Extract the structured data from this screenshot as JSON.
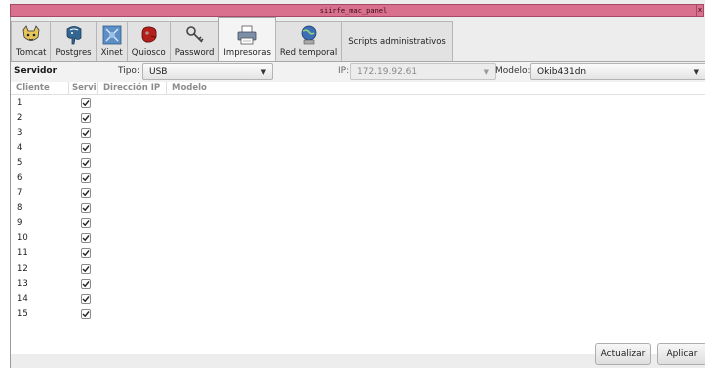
{
  "window": {
    "title": "siirfe_mac_panel",
    "close_glyph": "x"
  },
  "tabs": [
    {
      "label": "Tomcat",
      "icon": "tomcat-icon"
    },
    {
      "label": "Postgres",
      "icon": "postgres-elephant-icon"
    },
    {
      "label": "Xinet",
      "icon": "xinet-icon"
    },
    {
      "label": "Quiosco",
      "icon": "quiosco-icon"
    },
    {
      "label": "Password",
      "icon": "keys-icon"
    },
    {
      "label": "Impresoras",
      "icon": "printer-icon",
      "active": true
    },
    {
      "label": "Red temporal",
      "icon": "network-globe-icon"
    },
    {
      "label": "Scripts administrativos"
    }
  ],
  "toolbar": {
    "servidor_label": "Servidor",
    "tipo_label": "Tipo:",
    "tipo_value": "USB",
    "ip_label": "IP:",
    "ip_value": "172.19.92.61",
    "modelo_label": "Modelo:",
    "modelo_value": "Okib431dn"
  },
  "table": {
    "headers": [
      "Cliente",
      "Servi",
      "Dirección IP",
      "Modelo"
    ],
    "rows": [
      {
        "cliente": "1",
        "checked": true
      },
      {
        "cliente": "2",
        "checked": true
      },
      {
        "cliente": "3",
        "checked": true
      },
      {
        "cliente": "4",
        "checked": true
      },
      {
        "cliente": "5",
        "checked": true
      },
      {
        "cliente": "6",
        "checked": true
      },
      {
        "cliente": "7",
        "checked": true
      },
      {
        "cliente": "8",
        "checked": true
      },
      {
        "cliente": "9",
        "checked": true
      },
      {
        "cliente": "10",
        "checked": true
      },
      {
        "cliente": "11",
        "checked": true
      },
      {
        "cliente": "12",
        "checked": true
      },
      {
        "cliente": "13",
        "checked": true
      },
      {
        "cliente": "14",
        "checked": true
      },
      {
        "cliente": "15",
        "checked": true
      }
    ]
  },
  "buttons": {
    "actualizar": "Actualizar",
    "aplicar": "Aplicar"
  },
  "colors": {
    "titlebar": "#d9708e",
    "window_bg": "#ededed",
    "table_bg": "#ffffff"
  }
}
